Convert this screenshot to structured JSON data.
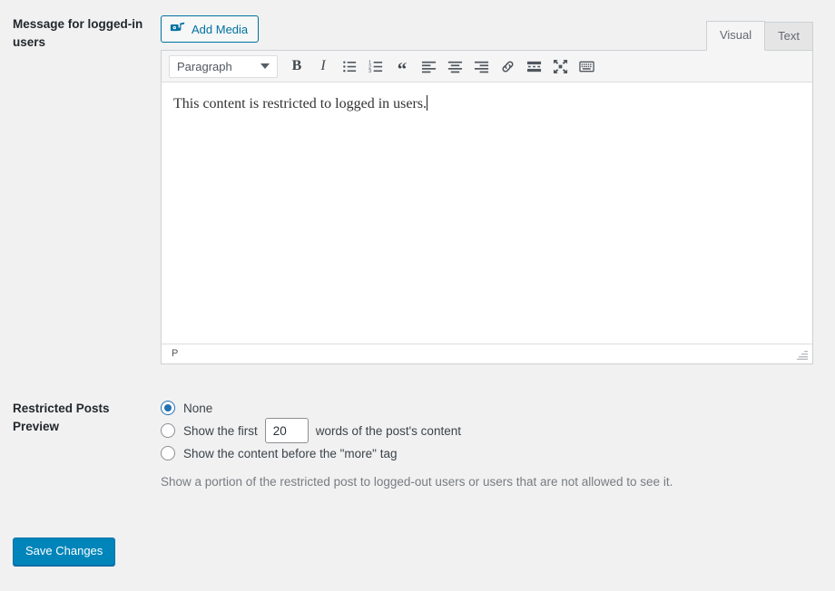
{
  "fields": {
    "editor_label": "Message for logged-in users",
    "preview_label": "Restricted Posts Preview"
  },
  "editor": {
    "add_media_label": "Add Media",
    "add_media_icon": "media-icon",
    "tabs": [
      {
        "label": "Visual",
        "active": true
      },
      {
        "label": "Text",
        "active": false
      }
    ],
    "format_select": {
      "value": "Paragraph",
      "caret_icon": "chevron-down-icon"
    },
    "toolbar_buttons": [
      {
        "name": "bold-icon",
        "label": "B"
      },
      {
        "name": "italic-icon",
        "label": "I"
      },
      {
        "name": "bulleted-list-icon",
        "label": ""
      },
      {
        "name": "numbered-list-icon",
        "label": ""
      },
      {
        "name": "blockquote-icon",
        "label": "“"
      },
      {
        "name": "align-left-icon",
        "label": ""
      },
      {
        "name": "align-center-icon",
        "label": ""
      },
      {
        "name": "align-right-icon",
        "label": ""
      },
      {
        "name": "link-icon",
        "label": ""
      },
      {
        "name": "read-more-icon",
        "label": ""
      },
      {
        "name": "fullscreen-icon",
        "label": ""
      },
      {
        "name": "toolbar-toggle-icon",
        "label": ""
      }
    ],
    "content": "This content is restricted to logged in users.",
    "status_path": "P",
    "resize_handle": "resize-grip-icon"
  },
  "preview_options": [
    {
      "label": "None",
      "checked": true
    },
    {
      "label": "Show the first",
      "checked": false,
      "suffix": "words of the post's content",
      "value": "20"
    },
    {
      "label": "Show the content before the \"more\" tag",
      "checked": false
    }
  ],
  "help_text": "Show a portion of the restricted post to logged-out users or users that are not allowed to see it.",
  "actions": {
    "save_label": "Save Changes"
  },
  "colors": {
    "accent": "#0085ba",
    "link": "#0071a1",
    "radio_checked": "#2271b1",
    "background": "#f1f1f1"
  }
}
